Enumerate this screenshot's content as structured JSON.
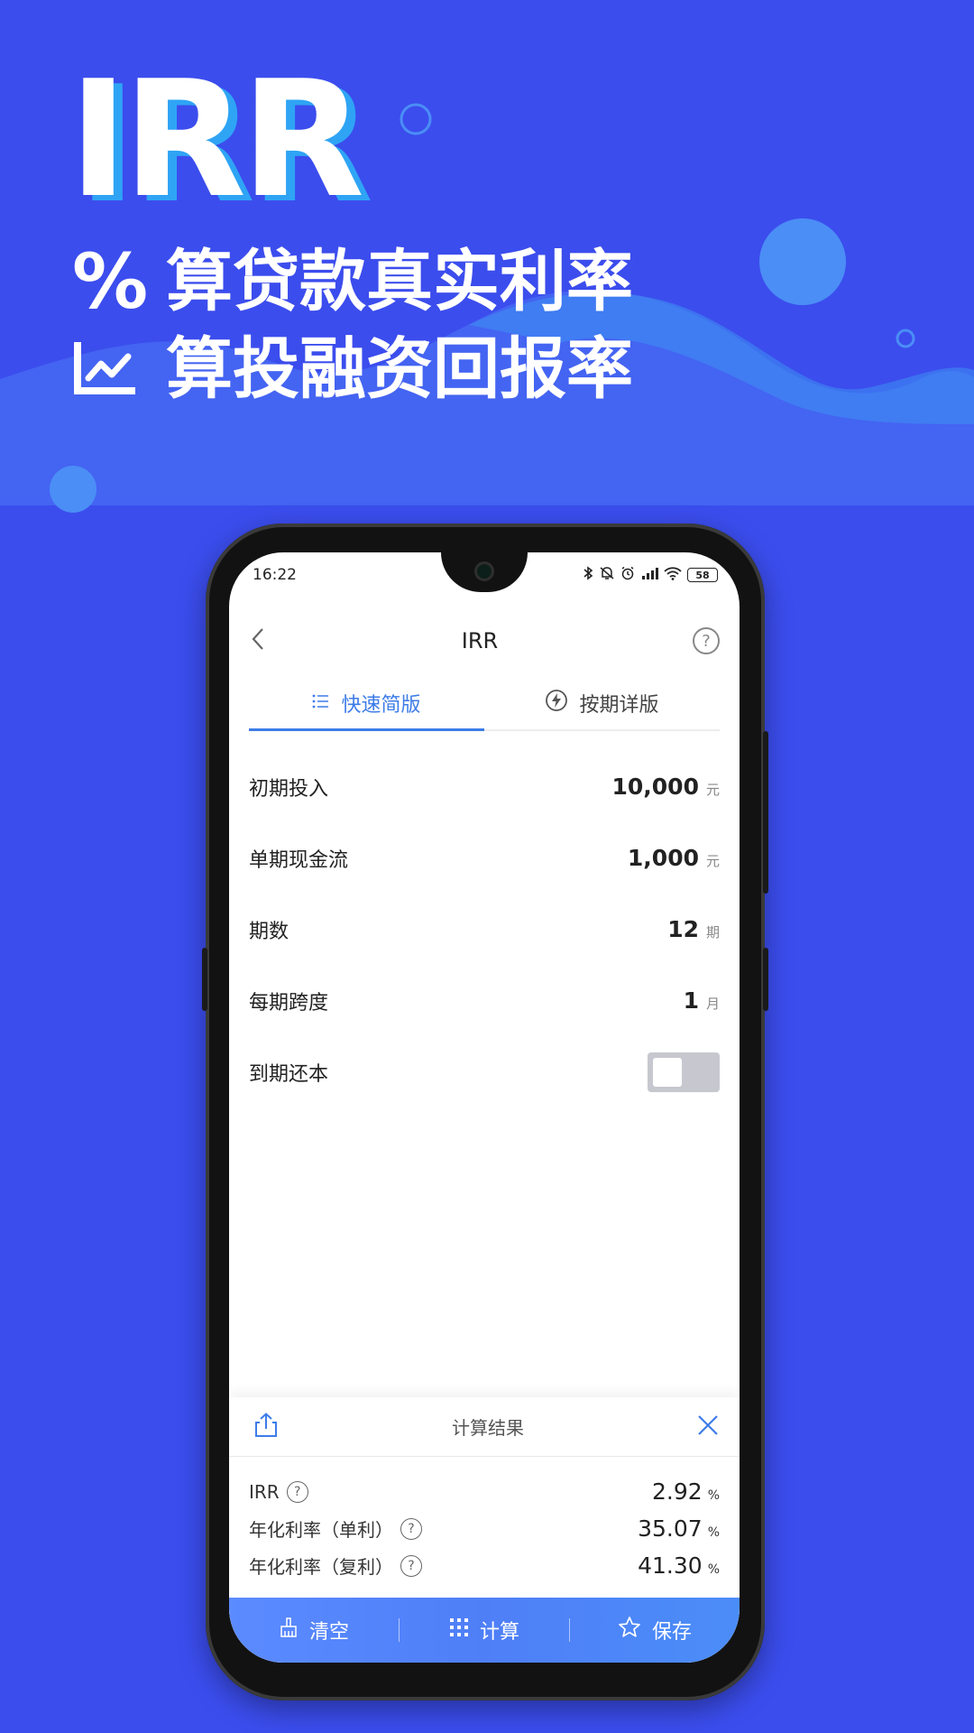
{
  "hero": {
    "title": "IRR",
    "line1_symbol": "%",
    "line1_text": "算贷款真实利率",
    "line2_text": "算投融资回报率"
  },
  "status_bar": {
    "time": "16:22",
    "battery": "58"
  },
  "nav": {
    "title": "IRR",
    "help_label": "?"
  },
  "tabs": [
    {
      "label": "快速简版",
      "active": true
    },
    {
      "label": "按期详版",
      "active": false
    }
  ],
  "form": {
    "rows": [
      {
        "label": "初期投入",
        "value": "10,000",
        "unit": "元"
      },
      {
        "label": "单期现金流",
        "value": "1,000",
        "unit": "元"
      },
      {
        "label": "期数",
        "value": "12",
        "unit": "期"
      },
      {
        "label": "每期跨度",
        "value": "1",
        "unit": "月"
      }
    ],
    "toggle": {
      "label": "到期还本",
      "on": false
    }
  },
  "result": {
    "title": "计算结果",
    "rows": [
      {
        "label": "IRR",
        "value": "2.92",
        "unit": "%"
      },
      {
        "label": "年化利率（单利）",
        "value": "35.07",
        "unit": "%"
      },
      {
        "label": "年化利率（复利）",
        "value": "41.30",
        "unit": "%"
      }
    ]
  },
  "bottom_bar": {
    "clear": "清空",
    "calculate": "计算",
    "save": "保存"
  },
  "colors": {
    "background": "#3b4ded",
    "accent": "#3d7ce8",
    "bottom_bar": "#5b8bff"
  }
}
